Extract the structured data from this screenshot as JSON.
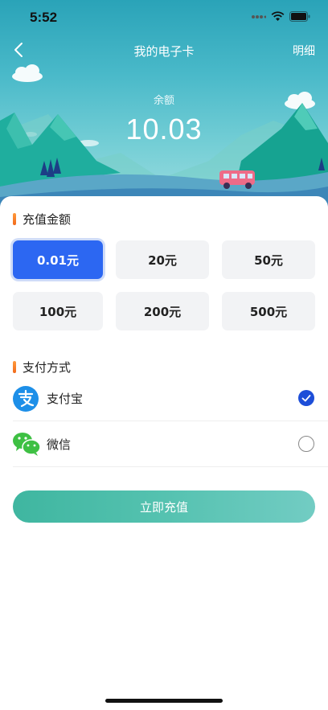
{
  "status_bar": {
    "time": "5:52"
  },
  "nav": {
    "title": "我的电子卡",
    "right_link": "明细"
  },
  "balance": {
    "label": "余额",
    "value": "10.03"
  },
  "recharge_amount": {
    "title": "充值金额",
    "options": [
      "0.01元",
      "20元",
      "50元",
      "100元",
      "200元",
      "500元"
    ],
    "selected_index": 0
  },
  "payment": {
    "title": "支付方式",
    "methods": [
      {
        "label": "支付宝",
        "icon": "alipay-icon",
        "checked": true
      },
      {
        "label": "微信",
        "icon": "wechat-icon",
        "checked": false
      }
    ]
  },
  "action": {
    "recharge_label": "立即充值"
  },
  "colors": {
    "accent_blue": "#2c67f2",
    "check_blue": "#1d4ed8",
    "button_teal": "#55c2b0",
    "section_marker": "#f26a1b",
    "alipay_blue": "#1d8fe8",
    "wechat_green": "#3ec043"
  }
}
